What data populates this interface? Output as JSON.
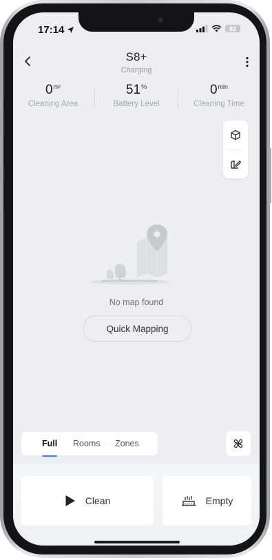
{
  "status_bar": {
    "time": "17:14",
    "battery": "82"
  },
  "header": {
    "title": "S8+",
    "subtitle": "Charging"
  },
  "stats": [
    {
      "value": "0",
      "unit": "m²",
      "label": "Cleaning Area"
    },
    {
      "value": "51",
      "unit": "%",
      "label": "Battery Level"
    },
    {
      "value": "0",
      "unit": "min",
      "label": "Cleaning Time"
    }
  ],
  "map": {
    "empty_text": "No map found",
    "quick_mapping_label": "Quick Mapping"
  },
  "mode_tabs": [
    {
      "label": "Full",
      "active": true
    },
    {
      "label": "Rooms",
      "active": false
    },
    {
      "label": "Zones",
      "active": false
    }
  ],
  "actions": {
    "clean_label": "Clean",
    "empty_label": "Empty"
  },
  "icons": {
    "back": "chevron-left-icon",
    "more": "more-vertical-icon",
    "map_3d": "cube-icon",
    "map_edit": "map-edit-icon",
    "fan": "fan-icon",
    "play": "play-icon",
    "dustbin": "dock-empty-icon"
  },
  "colors": {
    "accent": "#3b82f6",
    "screen_bg": "#eceef1"
  }
}
